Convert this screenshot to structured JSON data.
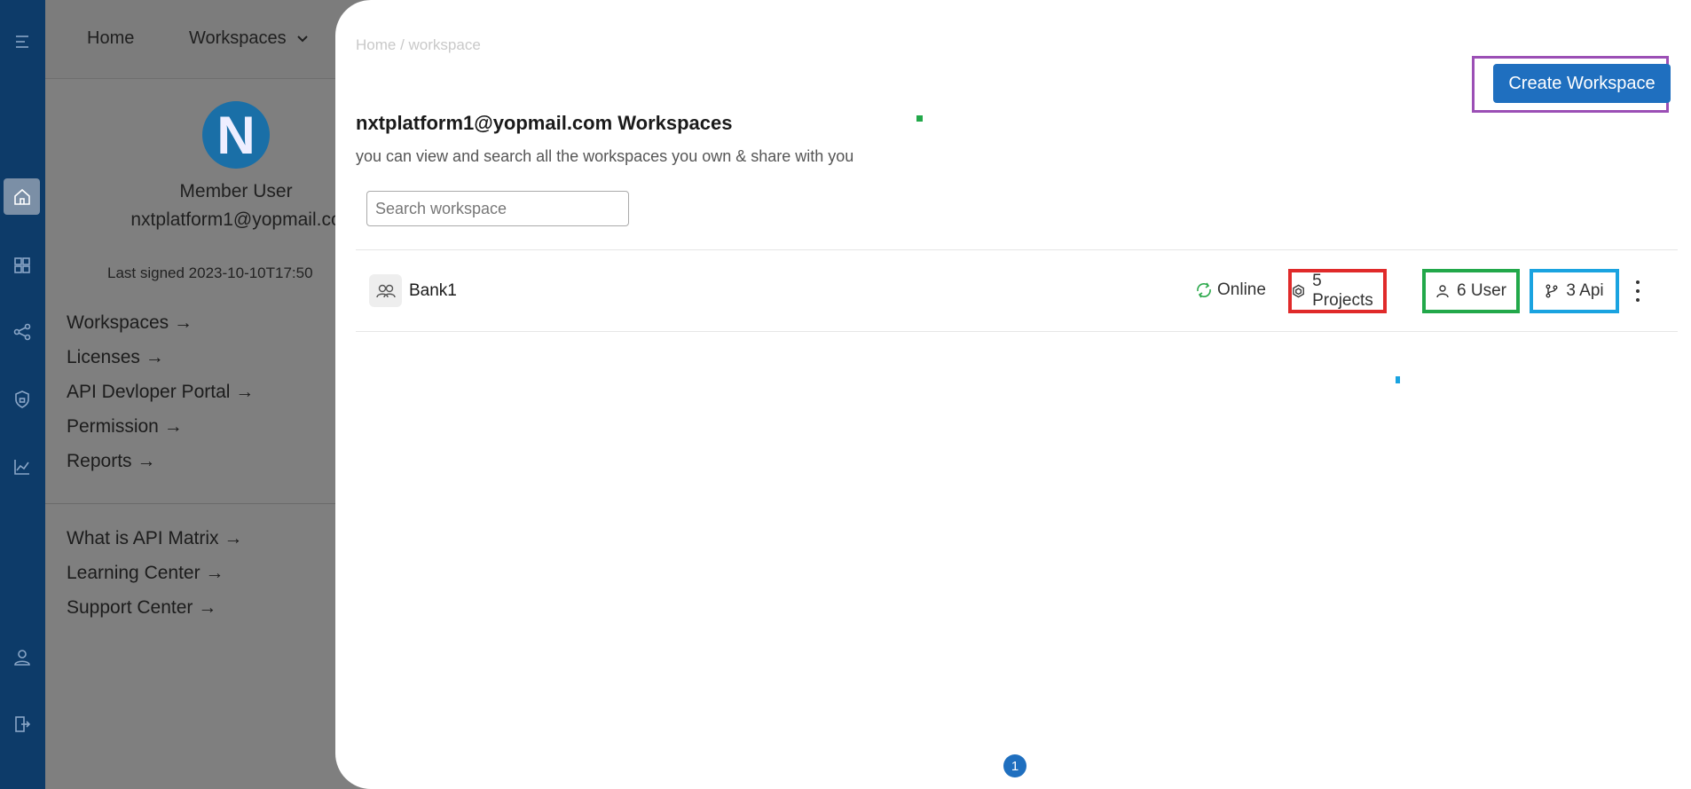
{
  "rail": {
    "icons": [
      "menu-icon",
      "home-icon",
      "dashboard-icon",
      "share-nodes-icon",
      "shield-icon",
      "chart-icon",
      "user-icon",
      "logout-icon"
    ]
  },
  "topnav": {
    "home": "Home",
    "workspaces": "Workspaces"
  },
  "profile": {
    "avatar_letter": "N",
    "name": "Member User",
    "email": "nxtplatform1@yopmail.co",
    "last_signed": "Last signed 2023-10-10T17:50",
    "links": [
      "Workspaces →",
      "Licenses →",
      "API Devloper Portal →",
      "Permission →",
      "Reports →"
    ],
    "help_links": [
      "What is API Matrix →",
      "Learning Center →",
      "Support Center →"
    ]
  },
  "drawer": {
    "breadcrumb": "Home / workspace",
    "create_label": "Create Workspace",
    "title": "nxtplatform1@yopmail.com Workspaces",
    "subtitle": "you can view and search all the workspaces you own & share with you",
    "search_placeholder": "Search workspace",
    "workspace": {
      "name": "Bank1",
      "status": "Online",
      "projects": "5 Projects",
      "users": "6 User",
      "apis": "3 Api"
    },
    "page": "1"
  },
  "colors": {
    "rail": "#0d3b69",
    "primary": "#1f6fbf",
    "status_green": "#2aa84a",
    "outline_purple": "#9b4fb5",
    "outline_red": "#e02a2a",
    "outline_green": "#22a84a",
    "outline_blue": "#1aa3e0"
  }
}
